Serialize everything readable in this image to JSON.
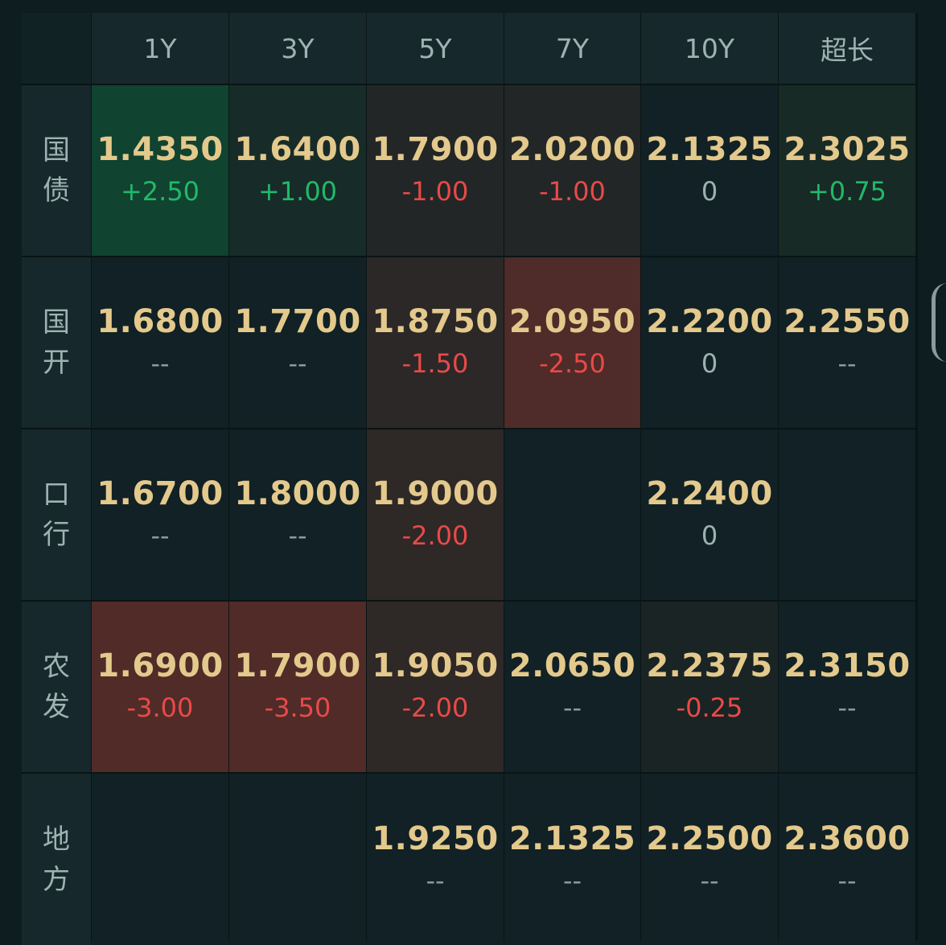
{
  "columns": [
    "1Y",
    "3Y",
    "5Y",
    "7Y",
    "10Y",
    "超长"
  ],
  "rows": [
    {
      "label": [
        "国",
        "债"
      ],
      "cells": [
        {
          "rate": "1.4350",
          "change": "+2.50",
          "kind": "pos",
          "bg": "#104330"
        },
        {
          "rate": "1.6400",
          "change": "+1.00",
          "kind": "pos",
          "bg": "#172c28"
        },
        {
          "rate": "1.7900",
          "change": "-1.00",
          "kind": "neg",
          "bg": "#232626"
        },
        {
          "rate": "2.0200",
          "change": "-1.00",
          "kind": "neg",
          "bg": "#232626"
        },
        {
          "rate": "2.1325",
          "change": "0",
          "kind": "zero",
          "bg": "#112125"
        },
        {
          "rate": "2.3025",
          "change": "+0.75",
          "kind": "pos",
          "bg": "#172a25"
        }
      ]
    },
    {
      "label": [
        "国",
        "开"
      ],
      "cells": [
        {
          "rate": "1.6800",
          "change": "--",
          "kind": "none",
          "bg": "#112125"
        },
        {
          "rate": "1.7700",
          "change": "--",
          "kind": "none",
          "bg": "#112125"
        },
        {
          "rate": "1.8750",
          "change": "-1.50",
          "kind": "neg",
          "bg": "#2c2828"
        },
        {
          "rate": "2.0950",
          "change": "-2.50",
          "kind": "neg",
          "bg": "#4f2b29"
        },
        {
          "rate": "2.2200",
          "change": "0",
          "kind": "zero",
          "bg": "#112125"
        },
        {
          "rate": "2.2550",
          "change": "--",
          "kind": "none",
          "bg": "#112125"
        }
      ]
    },
    {
      "label": [
        "口",
        "行"
      ],
      "cells": [
        {
          "rate": "1.6700",
          "change": "--",
          "kind": "none",
          "bg": "#112125"
        },
        {
          "rate": "1.8000",
          "change": "--",
          "kind": "none",
          "bg": "#112125"
        },
        {
          "rate": "1.9000",
          "change": "-2.00",
          "kind": "neg",
          "bg": "#2e2827"
        },
        {
          "rate": "",
          "change": "",
          "kind": "none",
          "bg": "#112125"
        },
        {
          "rate": "2.2400",
          "change": "0",
          "kind": "zero",
          "bg": "#112125"
        },
        {
          "rate": "",
          "change": "",
          "kind": "none",
          "bg": "#112125"
        }
      ]
    },
    {
      "label": [
        "农",
        "发"
      ],
      "cells": [
        {
          "rate": "1.6900",
          "change": "-3.00",
          "kind": "neg",
          "bg": "#512b28"
        },
        {
          "rate": "1.7900",
          "change": "-3.50",
          "kind": "neg",
          "bg": "#512b28"
        },
        {
          "rate": "1.9050",
          "change": "-2.00",
          "kind": "neg",
          "bg": "#2e2827"
        },
        {
          "rate": "2.0650",
          "change": "--",
          "kind": "none",
          "bg": "#112125"
        },
        {
          "rate": "2.2375",
          "change": "-0.25",
          "kind": "neg",
          "bg": "#1a2424"
        },
        {
          "rate": "2.3150",
          "change": "--",
          "kind": "none",
          "bg": "#112125"
        }
      ]
    },
    {
      "label": [
        "地",
        "方"
      ],
      "cells": [
        {
          "rate": "",
          "change": "",
          "kind": "none",
          "bg": "#112125"
        },
        {
          "rate": "",
          "change": "",
          "kind": "none",
          "bg": "#112125"
        },
        {
          "rate": "1.9250",
          "change": "--",
          "kind": "none",
          "bg": "#112125"
        },
        {
          "rate": "2.1325",
          "change": "--",
          "kind": "none",
          "bg": "#112125"
        },
        {
          "rate": "2.2500",
          "change": "--",
          "kind": "none",
          "bg": "#112125"
        },
        {
          "rate": "2.3600",
          "change": "--",
          "kind": "none",
          "bg": "#112125"
        }
      ]
    }
  ],
  "colors": {
    "rate_text": "#e4c98d",
    "positive": "#22b86a",
    "negative": "#e84a48",
    "header_text": "#9fb2b3",
    "background": "#0e1d1f"
  }
}
